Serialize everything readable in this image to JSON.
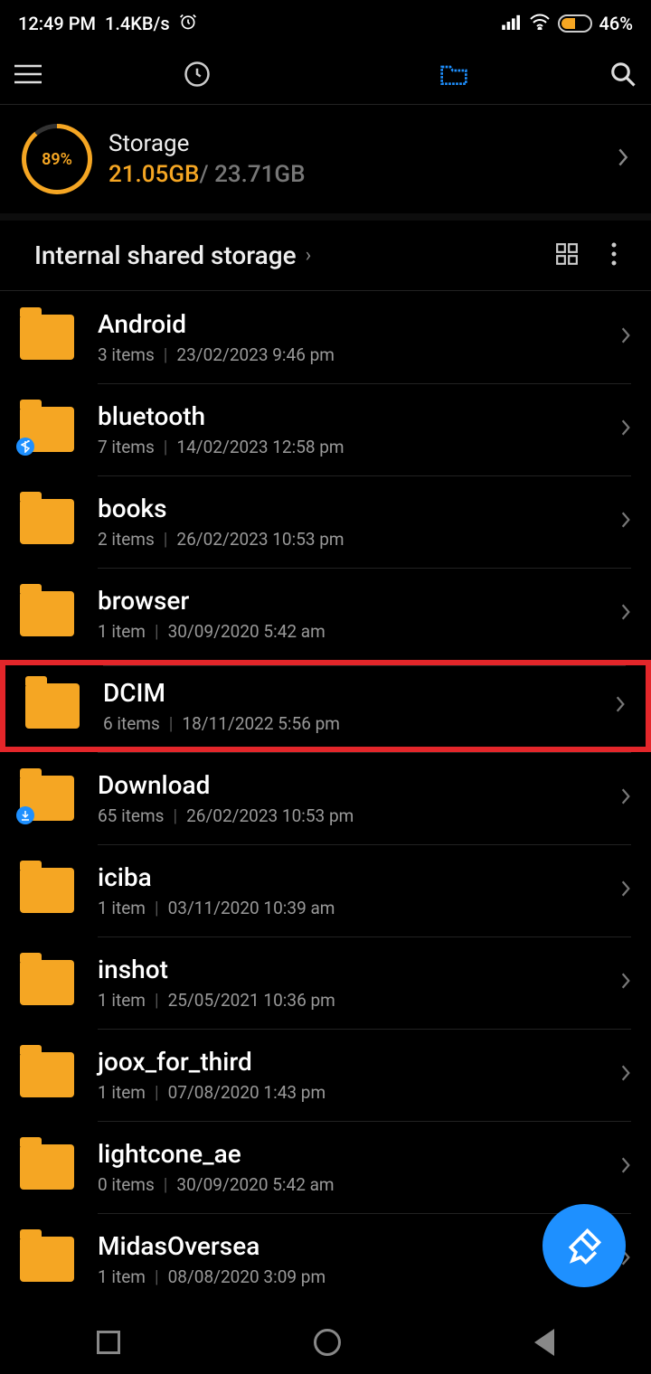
{
  "status": {
    "time": "12:49 PM",
    "net_speed": "1.4KB/s",
    "battery_pct": "46%"
  },
  "storage": {
    "ring_pct": "89%",
    "label": "Storage",
    "used": "21.05GB",
    "sep": "/ ",
    "total": "23.71GB"
  },
  "breadcrumb": {
    "path": "Internal shared storage"
  },
  "folders": [
    {
      "name": "Android",
      "items": "3 items",
      "date": "23/02/2023 9:46 pm",
      "badge": null,
      "highlight": false
    },
    {
      "name": "bluetooth",
      "items": "7 items",
      "date": "14/02/2023 12:58 pm",
      "badge": "bt",
      "highlight": false
    },
    {
      "name": "books",
      "items": "2 items",
      "date": "26/02/2023 10:53 pm",
      "badge": null,
      "highlight": false
    },
    {
      "name": "browser",
      "items": "1 item",
      "date": "30/09/2020 5:42 am",
      "badge": null,
      "highlight": false
    },
    {
      "name": "DCIM",
      "items": "6 items",
      "date": "18/11/2022 5:56 pm",
      "badge": null,
      "highlight": true
    },
    {
      "name": "Download",
      "items": "65 items",
      "date": "26/02/2023 10:53 pm",
      "badge": "dl",
      "highlight": false
    },
    {
      "name": "iciba",
      "items": "1 item",
      "date": "03/11/2020 10:39 am",
      "badge": null,
      "highlight": false
    },
    {
      "name": "inshot",
      "items": "1 item",
      "date": "25/05/2021 10:36 pm",
      "badge": null,
      "highlight": false
    },
    {
      "name": "joox_for_third",
      "items": "1 item",
      "date": "07/08/2020 1:43 pm",
      "badge": null,
      "highlight": false
    },
    {
      "name": "lightcone_ae",
      "items": "0 items",
      "date": "30/09/2020 5:42 am",
      "badge": null,
      "highlight": false
    },
    {
      "name": "MidasOversea",
      "items": "1 item",
      "date": "08/08/2020 3:09 pm",
      "badge": null,
      "highlight": false
    }
  ]
}
